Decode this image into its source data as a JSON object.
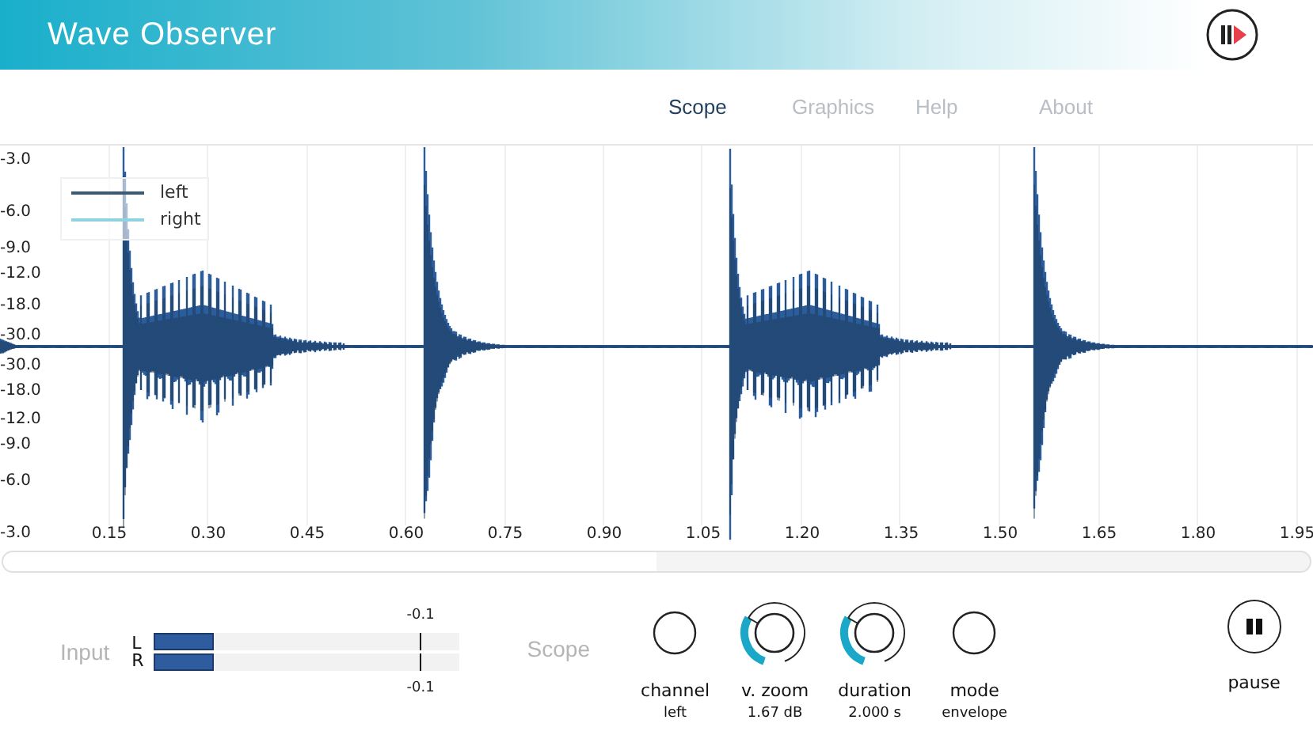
{
  "header": {
    "title": "Wave Observer"
  },
  "nav": [
    {
      "label": "Scope",
      "selected": true
    },
    {
      "label": "Graphics",
      "selected": false
    },
    {
      "label": "Help",
      "selected": false
    },
    {
      "label": "About",
      "selected": false
    }
  ],
  "scope": {
    "y_labels": [
      "-3.0",
      "-6.0",
      "-9.0",
      "-12.0",
      "-18.0",
      "-30.0",
      "-30.0",
      "-18.0",
      "-12.0",
      "-9.0",
      "-6.0",
      "-3.0"
    ],
    "x_labels": [
      "0.15",
      "0.30",
      "0.45",
      "0.60",
      "0.75",
      "0.90",
      "1.05",
      "1.20",
      "1.35",
      "1.50",
      "1.65",
      "1.80",
      "1.95"
    ],
    "legend": [
      {
        "label": "left",
        "color": "#3d5a73"
      },
      {
        "label": "right",
        "color": "#8fd3e0"
      }
    ]
  },
  "input": {
    "label": "Input",
    "meters": [
      {
        "channel": "L",
        "level": 0.2,
        "reading": "-0.1"
      },
      {
        "channel": "R",
        "level": 0.2,
        "reading": "-0.1"
      }
    ]
  },
  "controls": {
    "label": "Scope",
    "knobs": [
      {
        "kind": "button",
        "label": "channel",
        "value": "left"
      },
      {
        "kind": "dial",
        "label": "v. zoom",
        "value": "1.67 dB"
      },
      {
        "kind": "dial",
        "label": "duration",
        "value": "2.000 s"
      },
      {
        "kind": "button",
        "label": "mode",
        "value": "envelope"
      }
    ]
  },
  "pause": {
    "label": "pause"
  }
}
